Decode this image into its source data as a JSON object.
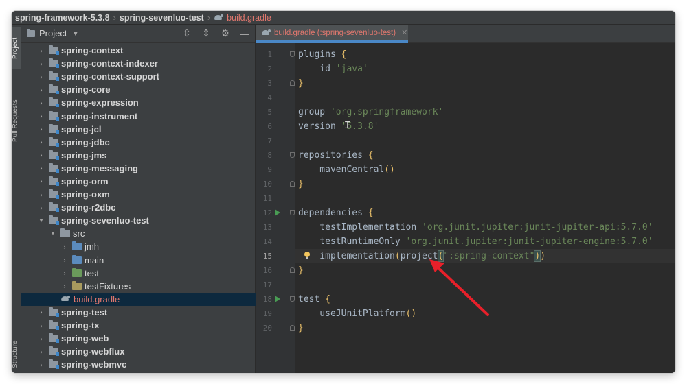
{
  "breadcrumb": {
    "items": [
      "spring-framework-5.3.8",
      "spring-sevenluo-test",
      "build.gradle"
    ]
  },
  "toolstrip": {
    "project": "Project",
    "pull_requests": "Pull Requests",
    "structure": "Structure"
  },
  "project_panel": {
    "title": "Project",
    "tree": [
      {
        "label": "spring-context",
        "type": "module",
        "depth": 0,
        "expanded": false
      },
      {
        "label": "spring-context-indexer",
        "type": "module",
        "depth": 0,
        "expanded": false
      },
      {
        "label": "spring-context-support",
        "type": "module",
        "depth": 0,
        "expanded": false
      },
      {
        "label": "spring-core",
        "type": "module",
        "depth": 0,
        "expanded": false
      },
      {
        "label": "spring-expression",
        "type": "module",
        "depth": 0,
        "expanded": false
      },
      {
        "label": "spring-instrument",
        "type": "module",
        "depth": 0,
        "expanded": false
      },
      {
        "label": "spring-jcl",
        "type": "module",
        "depth": 0,
        "expanded": false
      },
      {
        "label": "spring-jdbc",
        "type": "module",
        "depth": 0,
        "expanded": false
      },
      {
        "label": "spring-jms",
        "type": "module",
        "depth": 0,
        "expanded": false
      },
      {
        "label": "spring-messaging",
        "type": "module",
        "depth": 0,
        "expanded": false
      },
      {
        "label": "spring-orm",
        "type": "module",
        "depth": 0,
        "expanded": false
      },
      {
        "label": "spring-oxm",
        "type": "module",
        "depth": 0,
        "expanded": false
      },
      {
        "label": "spring-r2dbc",
        "type": "module",
        "depth": 0,
        "expanded": false
      },
      {
        "label": "spring-sevenluo-test",
        "type": "module",
        "depth": 0,
        "expanded": true
      },
      {
        "label": "src",
        "type": "folder",
        "depth": 1,
        "expanded": true
      },
      {
        "label": "jmh",
        "type": "folder-blue",
        "depth": 2,
        "expanded": false
      },
      {
        "label": "main",
        "type": "folder-blue",
        "depth": 2,
        "expanded": false
      },
      {
        "label": "test",
        "type": "folder-green",
        "depth": 2,
        "expanded": false
      },
      {
        "label": "testFixtures",
        "type": "folder-yellow",
        "depth": 2,
        "expanded": false
      },
      {
        "label": "build.gradle",
        "type": "gradle",
        "depth": 1,
        "selected": true
      },
      {
        "label": "spring-test",
        "type": "module",
        "depth": 0,
        "expanded": false
      },
      {
        "label": "spring-tx",
        "type": "module",
        "depth": 0,
        "expanded": false
      },
      {
        "label": "spring-web",
        "type": "module",
        "depth": 0,
        "expanded": false
      },
      {
        "label": "spring-webflux",
        "type": "module",
        "depth": 0,
        "expanded": false
      },
      {
        "label": "spring-webmvc",
        "type": "module",
        "depth": 0,
        "expanded": false
      }
    ]
  },
  "editor": {
    "tab_label": "build.gradle (:spring-sevenluo-test)",
    "current_line": 15,
    "lines": [
      {
        "n": "1",
        "tokens": [
          {
            "t": "plugins ",
            "c": "kw"
          },
          {
            "t": "{",
            "c": "brace"
          }
        ]
      },
      {
        "n": "2",
        "tokens": [
          {
            "t": "    id ",
            "c": "kw"
          },
          {
            "t": "'java'",
            "c": "str"
          }
        ]
      },
      {
        "n": "3",
        "tokens": [
          {
            "t": "}",
            "c": "brace"
          }
        ]
      },
      {
        "n": "4",
        "tokens": []
      },
      {
        "n": "5",
        "tokens": [
          {
            "t": "group ",
            "c": "kw"
          },
          {
            "t": "'org.springframework'",
            "c": "str"
          }
        ]
      },
      {
        "n": "6",
        "tokens": [
          {
            "t": "version ",
            "c": "kw"
          },
          {
            "t": "'5.3.8'",
            "c": "str"
          }
        ]
      },
      {
        "n": "7",
        "tokens": []
      },
      {
        "n": "8",
        "tokens": [
          {
            "t": "repositories ",
            "c": "kw"
          },
          {
            "t": "{",
            "c": "brace"
          }
        ]
      },
      {
        "n": "9",
        "tokens": [
          {
            "t": "    mavenCentral",
            "c": "kw"
          },
          {
            "t": "()",
            "c": "brace"
          }
        ]
      },
      {
        "n": "10",
        "tokens": [
          {
            "t": "}",
            "c": "brace"
          }
        ]
      },
      {
        "n": "11",
        "tokens": []
      },
      {
        "n": "12",
        "tokens": [
          {
            "t": "dependencies ",
            "c": "kw"
          },
          {
            "t": "{",
            "c": "brace"
          }
        ]
      },
      {
        "n": "13",
        "tokens": [
          {
            "t": "    testImplementation ",
            "c": "kw"
          },
          {
            "t": "'org.junit.jupiter:junit-jupiter-api:5.7.0'",
            "c": "str"
          }
        ]
      },
      {
        "n": "14",
        "tokens": [
          {
            "t": "    testRuntimeOnly ",
            "c": "kw"
          },
          {
            "t": "'org.junit.jupiter:junit-jupiter-engine:5.7.0'",
            "c": "str"
          }
        ]
      },
      {
        "n": "15",
        "tokens": [
          {
            "t": "    implementation",
            "c": "kw"
          },
          {
            "t": "(",
            "c": "brace"
          },
          {
            "t": "project",
            "c": "kw"
          },
          {
            "t": "(",
            "c": "brace hl"
          },
          {
            "t": "\":spring-context\"",
            "c": "str"
          },
          {
            "t": ")",
            "c": "brace hl"
          },
          {
            "t": ")",
            "c": "brace"
          }
        ]
      },
      {
        "n": "16",
        "tokens": [
          {
            "t": "}",
            "c": "brace"
          }
        ]
      },
      {
        "n": "17",
        "tokens": []
      },
      {
        "n": "18",
        "tokens": [
          {
            "t": "test ",
            "c": "kw"
          },
          {
            "t": "{",
            "c": "brace"
          }
        ]
      },
      {
        "n": "19",
        "tokens": [
          {
            "t": "    useJUnitPlatform",
            "c": "kw"
          },
          {
            "t": "()",
            "c": "brace"
          }
        ]
      },
      {
        "n": "20",
        "tokens": [
          {
            "t": "}",
            "c": "brace"
          }
        ]
      }
    ],
    "run_lines": [
      12,
      18
    ],
    "fold_open_lines": [
      1,
      8,
      12,
      18
    ],
    "fold_close_lines": [
      3,
      10,
      16,
      20
    ],
    "bulb_line": 15
  },
  "annotation": {
    "arrow_color": "#e8202a"
  }
}
